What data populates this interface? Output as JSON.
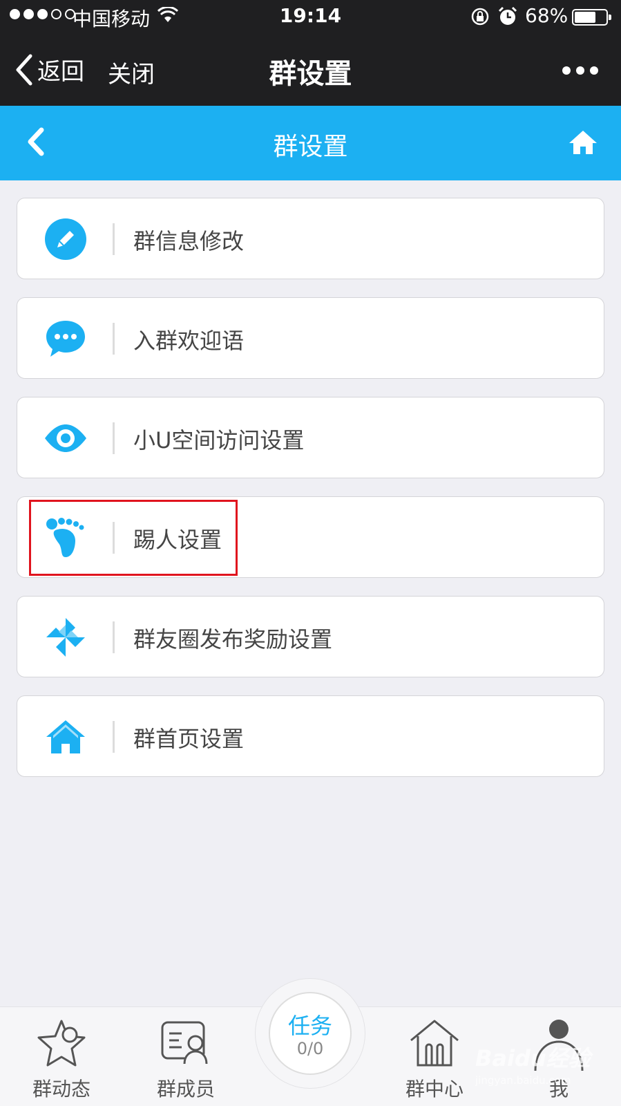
{
  "status_bar": {
    "carrier": "中国移动",
    "time": "19:14",
    "battery_percent": "68%",
    "battery_level": 0.68,
    "icons": [
      "signal-dots-icon",
      "wifi-icon",
      "rotation-lock-icon",
      "alarm-icon",
      "battery-icon"
    ]
  },
  "wx_nav": {
    "back_label": "返回",
    "close_label": "关闭",
    "title": "群设置",
    "more_icon": "more-dots-icon"
  },
  "header": {
    "title": "群设置",
    "back_icon": "chevron-left-icon",
    "home_icon": "home-icon"
  },
  "menu": {
    "items": [
      {
        "label": "群信息修改",
        "icon": "pencil-icon"
      },
      {
        "label": "入群欢迎语",
        "icon": "chat-bubble-icon"
      },
      {
        "label": "小U空间访问设置",
        "icon": "eye-icon"
      },
      {
        "label": "踢人设置",
        "icon": "footprint-icon"
      },
      {
        "label": "群友圈发布奖励设置",
        "icon": "pinwheel-icon"
      },
      {
        "label": "群首页设置",
        "icon": "house-icon"
      }
    ]
  },
  "tabbar": {
    "tabs": [
      {
        "label": "群动态",
        "icon": "star-icon"
      },
      {
        "label": "群成员",
        "icon": "member-card-icon"
      },
      {
        "label": "群中心",
        "icon": "group-center-icon"
      },
      {
        "label": "我",
        "icon": "person-icon"
      }
    ],
    "center": {
      "title": "任务",
      "count": "0/0"
    }
  },
  "watermark": {
    "line1": "Baidu经验",
    "line2": "jingyan.baidu.com"
  },
  "colors": {
    "accent": "#1cb0f2",
    "nav_dark": "#1f1f21",
    "background": "#efeff4",
    "highlight": "#e0141e"
  }
}
